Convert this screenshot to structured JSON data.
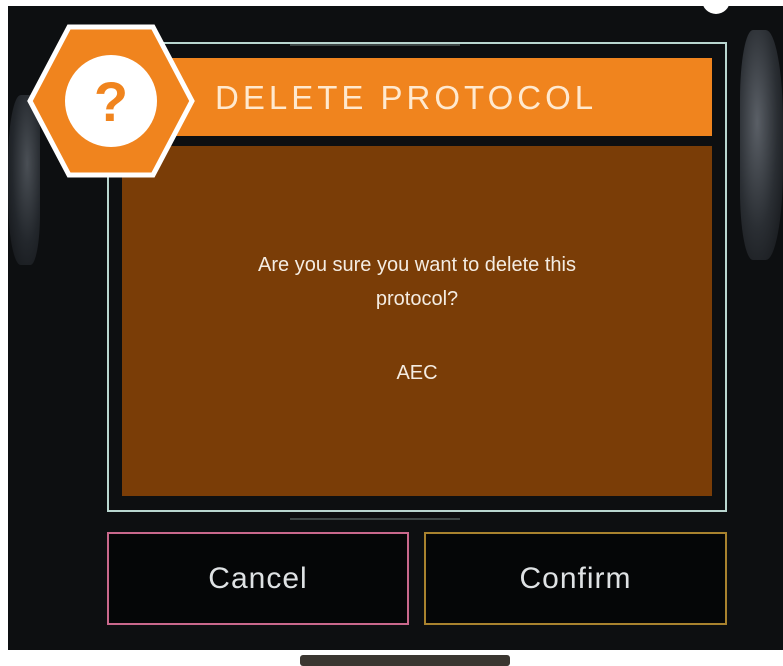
{
  "dialog": {
    "title": "DELETE PROTOCOL",
    "icon": "question-icon",
    "icon_glyph": "?",
    "message_line1": "Are you sure you want to delete this",
    "message_line2": "protocol?",
    "protocol_name": "AEC"
  },
  "buttons": {
    "cancel_label": "Cancel",
    "confirm_label": "Confirm"
  },
  "colors": {
    "accent": "#f0841e",
    "content_bg": "#7a3d07",
    "frame_border": "#b9d6d0",
    "cancel_border": "#c9688c",
    "confirm_border": "#a8822e"
  }
}
